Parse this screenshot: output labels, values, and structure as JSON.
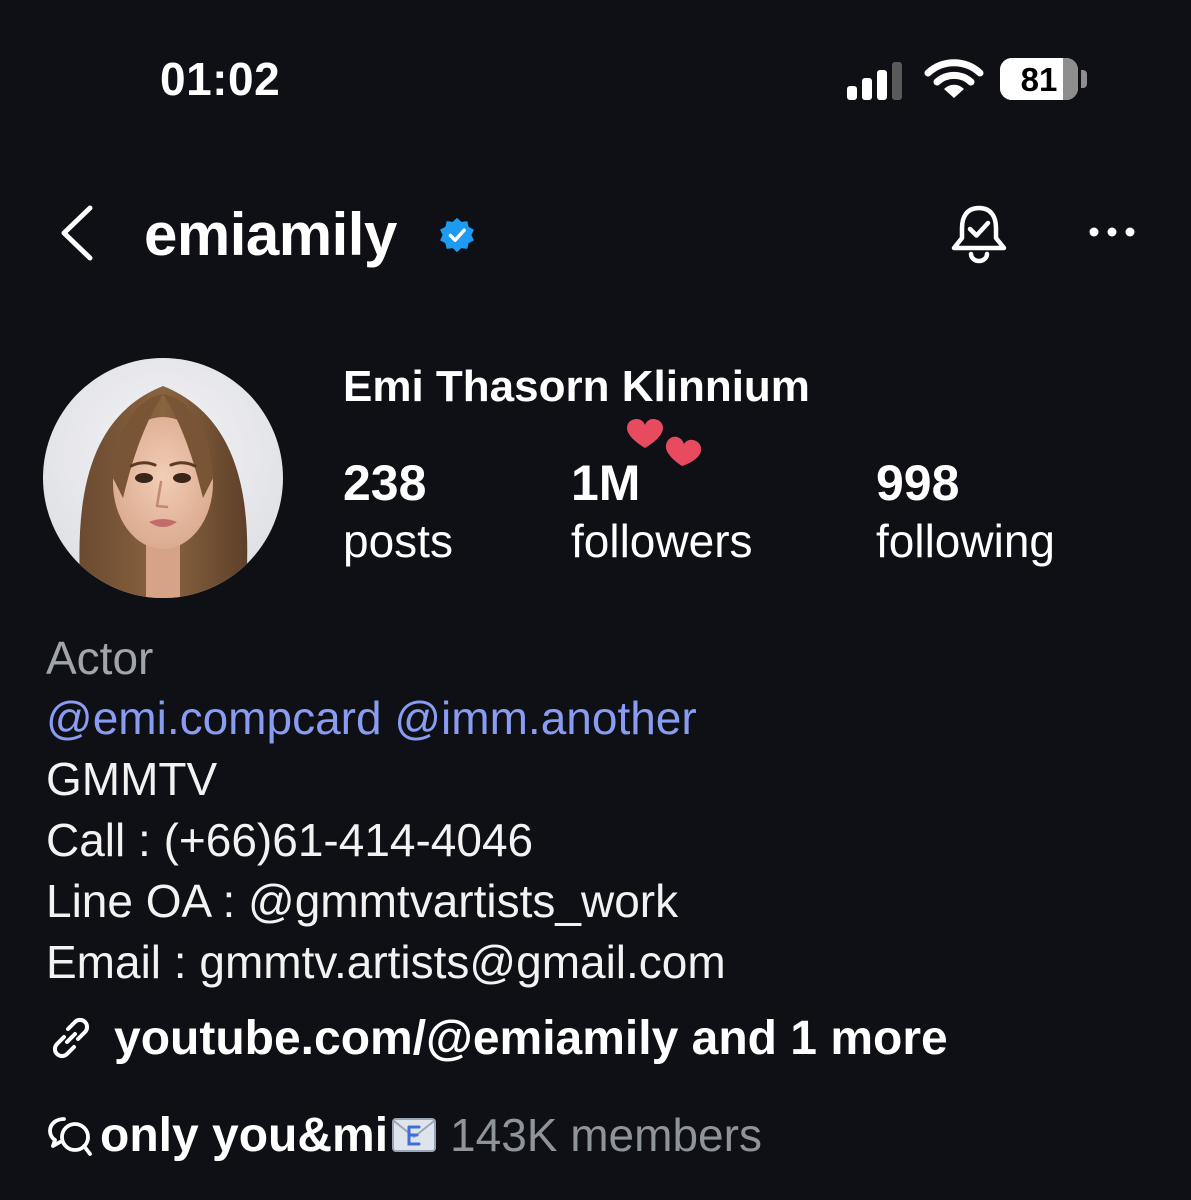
{
  "status_bar": {
    "time": "01:02",
    "battery_percent": 81,
    "battery_label": "81"
  },
  "header": {
    "username": "emiamily",
    "verified_icon": "verified-badge-icon",
    "colors": {
      "verified": "#1d9bf0"
    }
  },
  "profile": {
    "display_name": "Emi Thasorn Klinnium",
    "stats": [
      {
        "value": "238",
        "label": "posts"
      },
      {
        "value": "1M",
        "label": "followers"
      },
      {
        "value": "998",
        "label": "following"
      }
    ]
  },
  "bio": {
    "category": "Actor",
    "mentions": [
      "@emi.compcard",
      "@imm.another"
    ],
    "lines": [
      "GMMTV",
      "Call : (+66)61-414-4046",
      "Line OA : @gmmtvartists_work",
      "Email : gmmtv.artists@gmail.com"
    ],
    "link_text": "youtube.com/@emiamily and 1 more"
  },
  "channel": {
    "name": "only you&mi",
    "members": "143K members"
  },
  "colors": {
    "background": "#0e1015",
    "mention": "#8a9cf2",
    "muted": "#8f939a",
    "heart": "#e84a5f"
  }
}
